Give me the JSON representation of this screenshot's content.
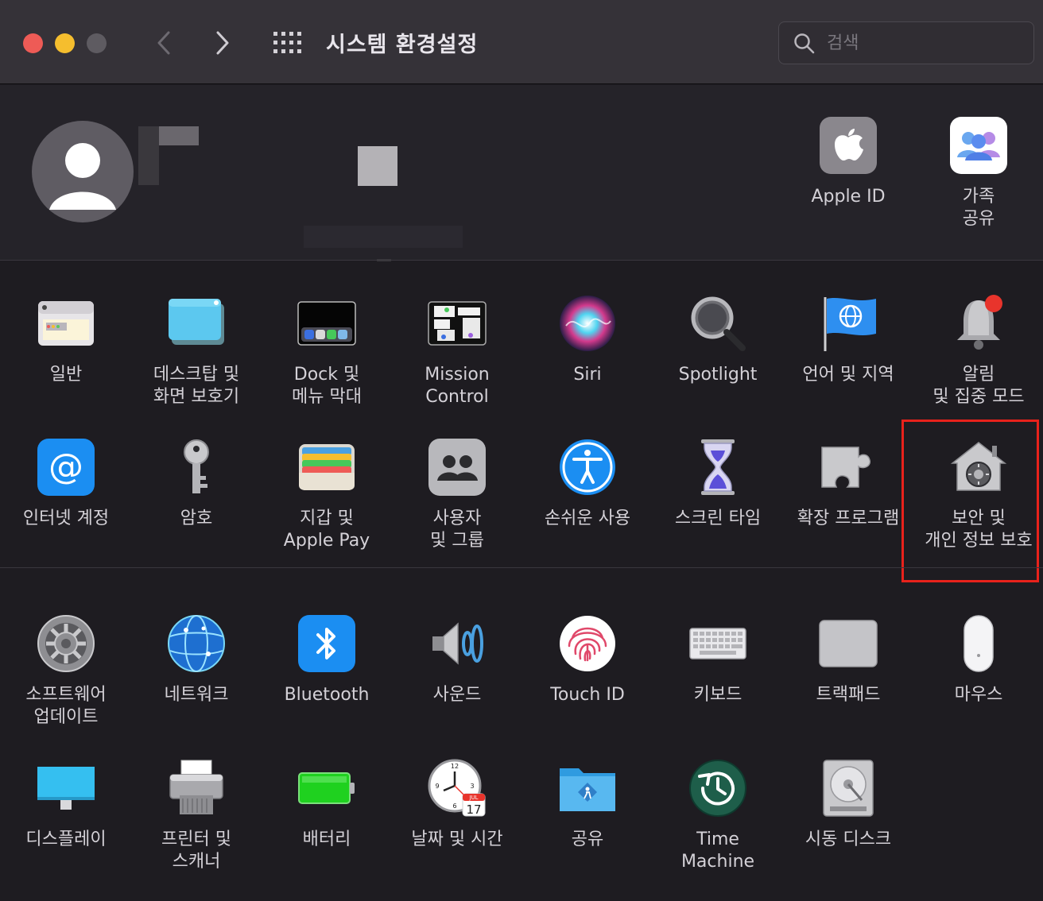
{
  "window": {
    "title": "시스템 환경설정"
  },
  "search": {
    "placeholder": "검색"
  },
  "account": {
    "apple_id": "Apple ID",
    "family": "가족\n공유"
  },
  "row1": [
    {
      "label": "일반"
    },
    {
      "label": "데스크탑 및\n화면 보호기"
    },
    {
      "label": "Dock 및\n메뉴 막대"
    },
    {
      "label": "Mission\nControl"
    },
    {
      "label": "Siri"
    },
    {
      "label": "Spotlight"
    },
    {
      "label": "언어 및 지역"
    },
    {
      "label": "알림\n및 집중 모드"
    }
  ],
  "row2": [
    {
      "label": "인터넷 계정"
    },
    {
      "label": "암호"
    },
    {
      "label": "지갑 및\nApple Pay"
    },
    {
      "label": "사용자\n및 그룹"
    },
    {
      "label": "손쉬운 사용"
    },
    {
      "label": "스크린 타임"
    },
    {
      "label": "확장 프로그램"
    },
    {
      "label": "보안 및\n개인 정보 보호"
    }
  ],
  "row3": [
    {
      "label": "소프트웨어\n업데이트"
    },
    {
      "label": "네트워크"
    },
    {
      "label": "Bluetooth"
    },
    {
      "label": "사운드"
    },
    {
      "label": "Touch ID"
    },
    {
      "label": "키보드"
    },
    {
      "label": "트랙패드"
    },
    {
      "label": "마우스"
    }
  ],
  "row4": [
    {
      "label": "디스플레이"
    },
    {
      "label": "프린터 및\n스캐너"
    },
    {
      "label": "배터리"
    },
    {
      "label": "날짜 및 시간"
    },
    {
      "label": "공유"
    },
    {
      "label": "Time\nMachine"
    },
    {
      "label": "시동 디스크"
    }
  ],
  "clock_date": {
    "month": "JUL",
    "day": "17"
  },
  "colors": {
    "highlight": "#e8221b",
    "background": "#1e1c21",
    "titlebar": "#353238"
  }
}
